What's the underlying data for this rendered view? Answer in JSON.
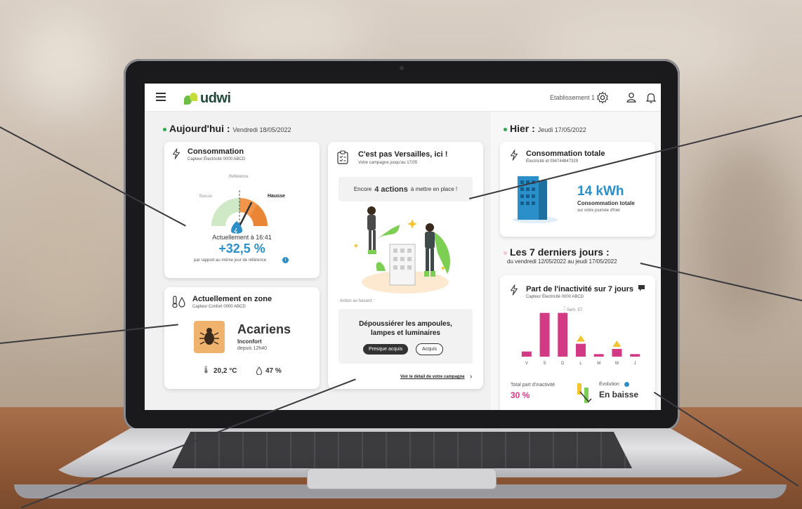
{
  "header": {
    "brand": "udwi",
    "establishment": "Etablissement 1",
    "icons": [
      "hamburger-icon",
      "gear-icon",
      "user-icon",
      "bell-icon"
    ]
  },
  "today": {
    "title": "Aujourd'hui :",
    "date": "Vendredi 18/05/2022"
  },
  "consumption_card": {
    "title": "Consommation",
    "sensor": "Capteur Électricité 0000 ABCD",
    "reference_label": "Référence",
    "low_label": "Baisse",
    "high_label": "Hausse",
    "current_time": "Actuellement à 16:41",
    "value": "+32,5 %",
    "note": "par rapport au même jour de référence",
    "gauge_level": 0.65
  },
  "zone_card": {
    "title": "Actuellement en zone",
    "sensor": "Capteur Confort 0000 ABCD",
    "alert": "Acariens",
    "status": "Inconfort",
    "since": "depuis 12h40",
    "temperature": "20,2 °C",
    "humidity": "47 %"
  },
  "campaign_card": {
    "title": "C'est pas Versailles, ici !",
    "subtitle": "Votre campagne jusqu'au 17/05",
    "actions_prefix": "Encore",
    "actions_count": "4 actions",
    "actions_suffix": "à mettre en place !",
    "random_label": "Action au hasard :",
    "action_text_1": "Dépoussiérer les ampoules,",
    "action_text_2": "lampes et luminaires",
    "btn_almost": "Presque acquis",
    "btn_acquired": "Acquis",
    "detail_link": "Voir le détail de votre campagne",
    "chevron": "›"
  },
  "yesterday": {
    "title": "Hier :",
    "date": "Jeudi 17/05/2022"
  },
  "total_card": {
    "title": "Consommation totale",
    "sensor": "Électricité id 094744847329",
    "value": "14 kWh",
    "label": "Consommation totale",
    "sublabel": "sur votre journée d'hier"
  },
  "week": {
    "title": "Les 7 derniers jours :",
    "range": "du vendredi 12/05/2022 au jeudi 17/05/2022"
  },
  "inactivity_card": {
    "title": "Part de l'inactivité sur 7 jours",
    "sensor": "Capteur Électricité 0000 ABCD",
    "week_label": "Sem. 57",
    "total_label": "Total part d'inactivité",
    "total_value": "30 %",
    "evolution_label": "Évolution",
    "evolution_value": "En baisse"
  },
  "colors": {
    "accent_blue": "#2b8fc9",
    "gauge_green": "#cfe8c6",
    "gauge_orange": "#f0964a",
    "bar_pink": "#d33a86",
    "warn_yellow": "#f4c430",
    "dot_green": "#2aa84a"
  },
  "chart_data": {
    "type": "bar",
    "categories": [
      "V",
      "S",
      "D",
      "L",
      "M",
      "M",
      "J"
    ],
    "values": [
      2,
      17,
      17,
      5,
      1,
      3,
      1
    ],
    "warnings": [
      false,
      false,
      false,
      true,
      false,
      true,
      false
    ],
    "ylim": [
      0,
      18
    ],
    "grid": false
  }
}
